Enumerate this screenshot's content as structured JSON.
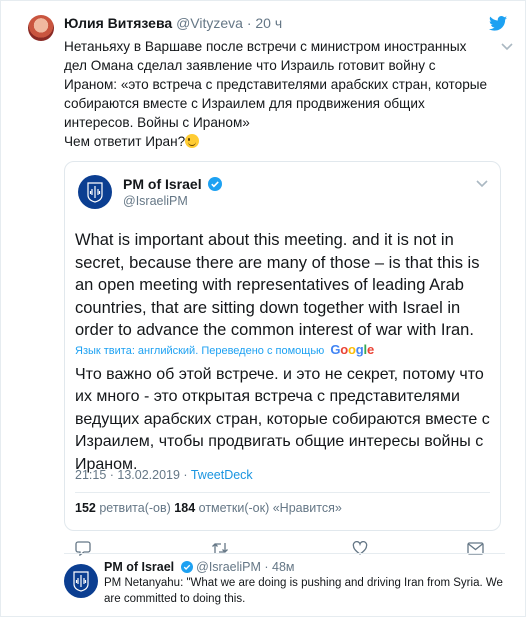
{
  "tweet": {
    "author_name": "Юлия Витязева",
    "handle": "@Vityzeva",
    "time": "20 ч",
    "text_lines": [
      "Нетаньяху в Варшаве после встречи с министром иностранных",
      "дел Омана сделал заявление что Израиль готовит войну с",
      "Ираном: «это встреча с представителями арабских стран, которые",
      "собираются вместе с Израилем для продвижения общих",
      "интересов. Войны с Ираном»",
      "Чем ответит Иран?"
    ],
    "emoji": "winking-face"
  },
  "quoted": {
    "name": "PM of Israel",
    "handle": "@IsraeliPM",
    "text": "What is important about this meeting. and it is not in secret, because there are many of those – is that this is an open meeting with representatives of leading Arab countries, that are sitting down together with Israel in order to advance the common interest of war with Iran.",
    "translation_note": "Язык твита: английский. Переведено с помощью",
    "google": [
      "G",
      "o",
      "o",
      "g",
      "l",
      "e"
    ],
    "translated_text": "Что важно об этой встрече. и это не секрет, потому что их много - это открытая встреча с представителями ведущих арабских стран, которые собираются вместе с Израилем, чтобы продвигать общие интересы войны с Ираном.",
    "timestamp": "21:15 · 13.02.2019 · ",
    "source": "TweetDeck",
    "retweets_count": "152",
    "retweets_label": "ретвита(-ов)",
    "likes_count": "184",
    "likes_label": "отметки(-ок) «Нравится»"
  },
  "reply": {
    "name": "PM of Israel",
    "handle_time": "@IsraeliPM · 48м",
    "text": "PM Netanyahu: \"What we are doing is pushing and driving Iran from Syria. We are committed to doing this."
  },
  "colors": {
    "accent": "#1da1f2",
    "muted": "#657786",
    "verified": "#1da1f2",
    "pm_avatar": "#0b3e91"
  }
}
